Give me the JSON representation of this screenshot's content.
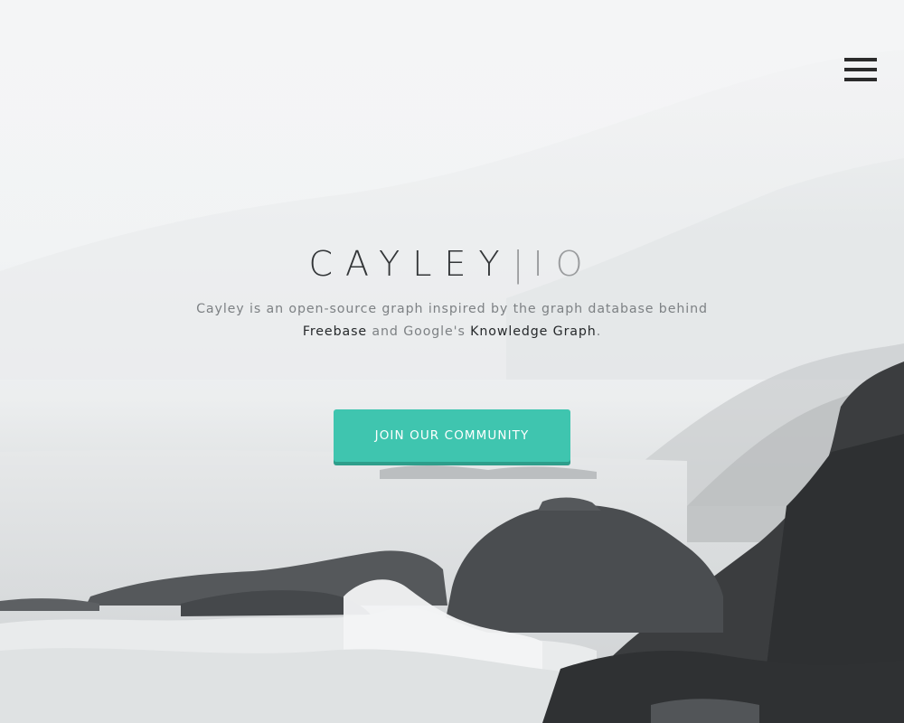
{
  "header": {
    "menu_icon": "hamburger-menu-icon"
  },
  "hero": {
    "logo": {
      "name": "CAYLEY",
      "separator": "|",
      "suffix": "IO"
    },
    "tagline": {
      "part1": "Cayley is an open-source graph inspired by the graph database behind",
      "link1": "Freebase",
      "part2": "and Google's",
      "link2": "Knowledge Graph",
      "part3": "."
    },
    "cta_label": "JOIN OUR COMMUNITY"
  },
  "colors": {
    "accent": "#3fc5af",
    "accent_shadow": "#2e9e8b",
    "logo_text": "#333638",
    "logo_muted": "#9a9c9e",
    "body_text": "#7d8184",
    "link_text": "#26292b"
  }
}
